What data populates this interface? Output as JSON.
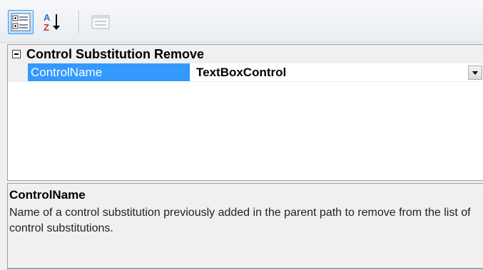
{
  "toolbar": {
    "categorized_icon": "categorized-view-icon",
    "alphabetical_icon": "alphabetical-sort-icon",
    "property_pages_icon": "property-pages-icon"
  },
  "grid": {
    "category": {
      "label": "Control Substitution Remove",
      "expanded": true
    },
    "properties": [
      {
        "name": "ControlName",
        "value": "TextBoxControl",
        "selected": true
      }
    ]
  },
  "description": {
    "title": "ControlName",
    "text": "Name of a control substitution previously added in the parent path to remove from the list of control substitutions."
  },
  "colors": {
    "selection": "#3399ff",
    "background": "#f0f0f0",
    "border": "#a0a0a0"
  }
}
